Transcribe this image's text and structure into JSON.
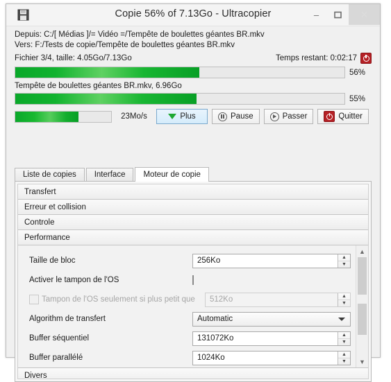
{
  "window": {
    "title": "Copie 56% of 7.13Go - Ultracopier",
    "icon": "floppy-save-icon",
    "buttons": {
      "minimize": "–",
      "maximize": "❐",
      "close": "✕"
    }
  },
  "transfer": {
    "from_line": "Depuis: C:/[ Médias ]/= Vidéo =/Tempête de boulettes géantes BR.mkv",
    "to_line": "Vers:  F:/Tests de copie/Tempête de boulettes géantes BR.mkv",
    "file_status": "Fichier 3/4, taille: 4.05Go/7.13Go",
    "remaining_label": "Temps restant: 0:02:17",
    "stop_icon": "power-icon"
  },
  "progress": {
    "total": {
      "percent_label": "56%",
      "percent": 56
    },
    "current_file_label": "Tempête de boulettes géantes BR.mkv, 6.96Go",
    "current": {
      "percent_label": "55%",
      "percent": 55
    },
    "speed": {
      "label": "23Mo/s",
      "percent": 66
    }
  },
  "actions": [
    {
      "label": "Plus",
      "icon": "triangle-down-icon",
      "state": "highlighted"
    },
    {
      "label": "Pause",
      "icon": "pause-icon",
      "state": "normal"
    },
    {
      "label": "Passer",
      "icon": "skip-icon",
      "state": "normal"
    },
    {
      "label": "Quitter",
      "icon": "power-icon",
      "state": "normal"
    }
  ],
  "tabs": [
    {
      "label": "Liste de copies",
      "active": false
    },
    {
      "label": "Interface",
      "active": false
    },
    {
      "label": "Moteur de copie",
      "active": true
    }
  ],
  "sections": [
    {
      "label": "Transfert"
    },
    {
      "label": "Erreur et collision"
    },
    {
      "label": "Controle"
    },
    {
      "label": "Performance"
    },
    {
      "label": "Divers"
    }
  ],
  "performance_fields": [
    {
      "label": "Taille de bloc",
      "control": "spinner",
      "value": "256Ko",
      "disabled": false
    },
    {
      "label": "Activer le tampon de l'OS",
      "control": "checkbox",
      "value": "",
      "checked": false,
      "disabled": false
    },
    {
      "label": "Tampon de l'OS seulement si plus petit que",
      "control": "spinner",
      "value": "512Ko",
      "disabled": true,
      "checked": false
    },
    {
      "label": "Algorithm de transfert",
      "control": "combo",
      "value": "Automatic",
      "disabled": false
    },
    {
      "label": "Buffer séquentiel",
      "control": "spinner",
      "value": "131072Ko",
      "disabled": false
    },
    {
      "label": "Buffer parallélé",
      "control": "spinner",
      "value": "1024Ko",
      "disabled": false
    }
  ],
  "scrollbar": {
    "up": "▲",
    "down": "▼"
  }
}
